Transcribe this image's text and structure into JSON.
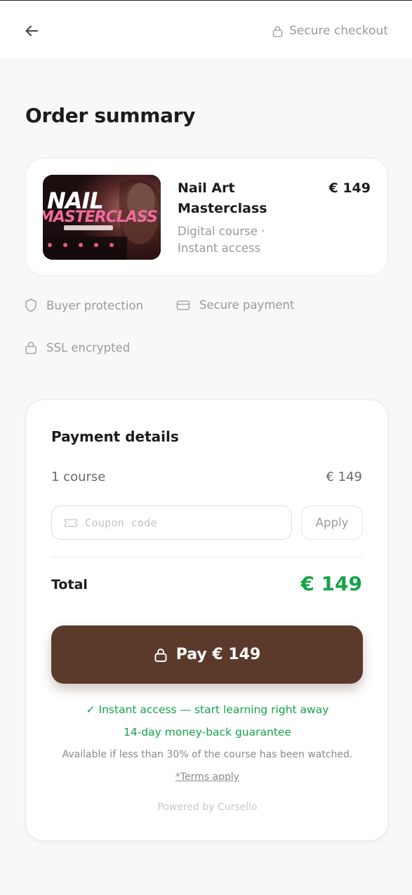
{
  "header": {
    "secure_label": "Secure checkout"
  },
  "page": {
    "title": "Order summary"
  },
  "product": {
    "name": "Nail Art Masterclass",
    "meta": "Digital course · Instant access",
    "price": "€ 149",
    "thumbnail": {
      "title_line1": "NAIL",
      "title_line2": "MASTERCLASS"
    }
  },
  "trust_badges": [
    {
      "label": "Buyer protection",
      "icon": "shield-icon"
    },
    {
      "label": "Secure payment",
      "icon": "credit-card-icon"
    },
    {
      "label": "SSL encrypted",
      "icon": "lock-icon"
    }
  ],
  "payment": {
    "title": "Payment details",
    "line_label": "1 course",
    "line_value": "€ 149",
    "coupon_placeholder": "Coupon code",
    "coupon_value": "",
    "apply_label": "Apply",
    "total_label": "Total",
    "total_value": "€ 149",
    "pay_label": "Pay € 149",
    "instant_access": "✓ Instant access — start learning right away",
    "guarantee": "14-day money-back guarantee",
    "guarantee_note": "Available if less than 30% of the course has been watched.",
    "terms_link": "*Terms apply",
    "powered_by": "Powered by Cursello"
  },
  "colors": {
    "accent_brown": "#5c3a2b",
    "success_green": "#16a34a",
    "muted_text": "#9a9a9a",
    "background": "#f8f8f8"
  }
}
